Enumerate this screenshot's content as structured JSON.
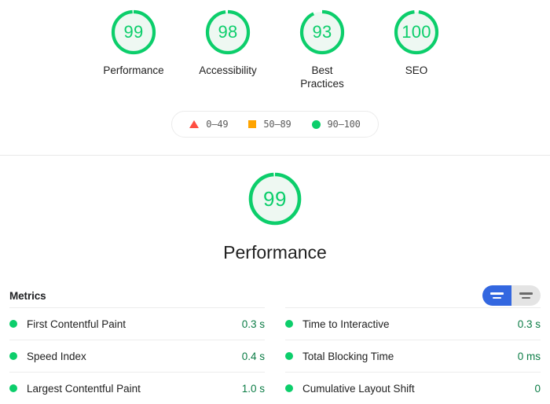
{
  "scores": {
    "gauges": [
      {
        "value": "99",
        "label": "Performance",
        "score": 99,
        "color": "#0cce6b",
        "track": "#eef8f2"
      },
      {
        "value": "98",
        "label": "Accessibility",
        "score": 98,
        "color": "#0cce6b",
        "track": "#eef8f2"
      },
      {
        "value": "93",
        "label": "Best Practices",
        "score": 93,
        "color": "#0cce6b",
        "track": "#eef8f2"
      },
      {
        "value": "100",
        "label": "SEO",
        "score": 100,
        "color": "#0cce6b",
        "track": "#eef8f2"
      }
    ]
  },
  "legend": {
    "items": [
      {
        "icon": "triangle-marker",
        "range": "0–49",
        "color": "#ff4e42"
      },
      {
        "icon": "square-marker",
        "range": "50–89",
        "color": "#ffa400"
      },
      {
        "icon": "circle-marker",
        "range": "90–100",
        "color": "#0cce6b"
      }
    ]
  },
  "performance": {
    "gauge": {
      "value": "99",
      "score": 99,
      "color": "#0cce6b"
    },
    "title": "Performance"
  },
  "metrics": {
    "heading": "Metrics",
    "toggle": {
      "active_option": "simple-view-toggle",
      "inactive_option": "detail-view-toggle",
      "active_color": "#3367e0",
      "inactive_color": "#e4e4e4"
    },
    "columns": [
      {
        "rows": [
          {
            "name": "First Contentful Paint",
            "value": "0.3 s",
            "status": "pass",
            "color": "#0cce6b"
          },
          {
            "name": "Speed Index",
            "value": "0.4 s",
            "status": "pass",
            "color": "#0cce6b"
          },
          {
            "name": "Largest Contentful Paint",
            "value": "1.0 s",
            "status": "pass",
            "color": "#0cce6b"
          }
        ]
      },
      {
        "rows": [
          {
            "name": "Time to Interactive",
            "value": "0.3 s",
            "status": "pass",
            "color": "#0cce6b"
          },
          {
            "name": "Total Blocking Time",
            "value": "0 ms",
            "status": "pass",
            "color": "#0cce6b"
          },
          {
            "name": "Cumulative Layout Shift",
            "value": "0",
            "status": "pass",
            "color": "#0cce6b"
          }
        ]
      }
    ]
  }
}
